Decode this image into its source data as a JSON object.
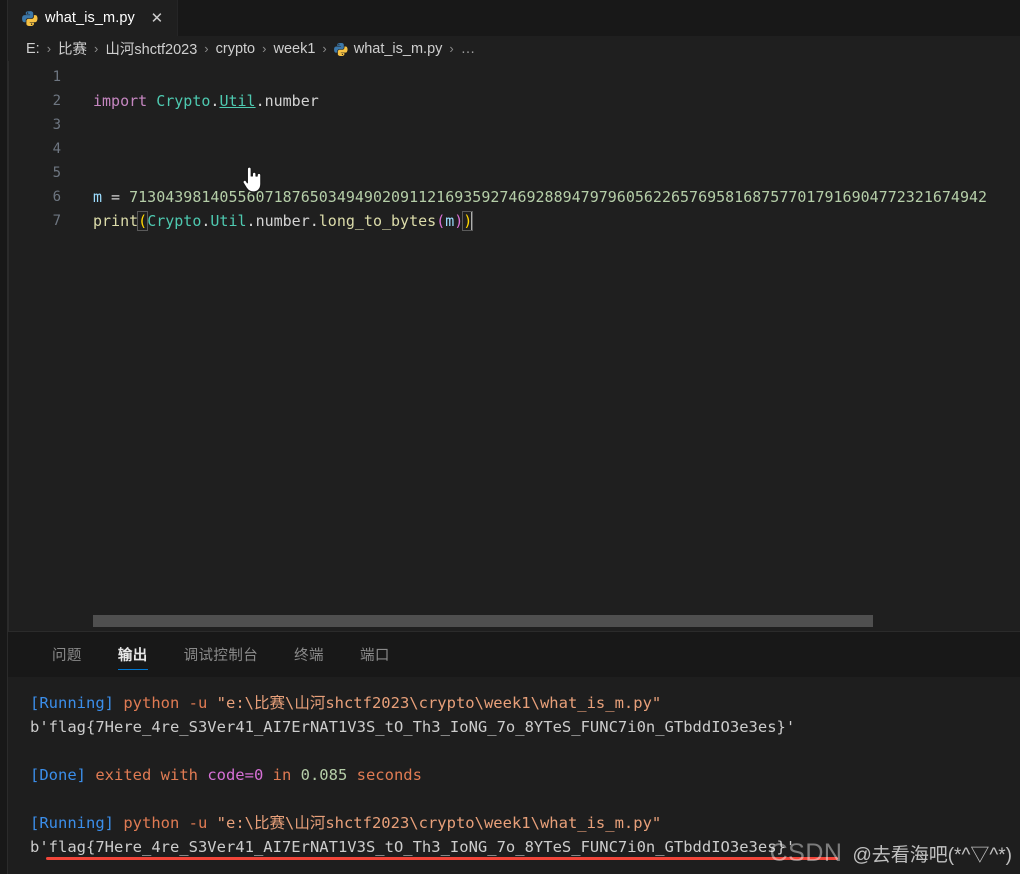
{
  "window": {
    "app": "Visual Studio Code"
  },
  "tabbar": {
    "tabs": [
      {
        "label": "what_is_m.py",
        "icon": "python-icon",
        "close": "✕",
        "active": true
      }
    ]
  },
  "breadcrumb": {
    "separator": "›",
    "items": [
      {
        "label": "E:"
      },
      {
        "label": "比赛"
      },
      {
        "label": "山河shctf2023"
      },
      {
        "label": "crypto"
      },
      {
        "label": "week1"
      },
      {
        "label": "what_is_m.py",
        "icon": "python-icon"
      },
      {
        "label": "…"
      }
    ]
  },
  "editor": {
    "line_numbers": [
      "1",
      "2",
      "3",
      "4",
      "5",
      "6",
      "7"
    ],
    "lines": [
      {
        "n": "1",
        "tokens": []
      },
      {
        "n": "2",
        "tokens": [
          {
            "t": "import ",
            "c": "kw"
          },
          {
            "t": "Crypto",
            "c": "mod"
          },
          {
            "t": ".",
            "c": "plain"
          },
          {
            "t": "Util",
            "c": "mod uline"
          },
          {
            "t": ".",
            "c": "plain"
          },
          {
            "t": "number",
            "c": "plain"
          }
        ]
      },
      {
        "n": "3",
        "tokens": []
      },
      {
        "n": "4",
        "tokens": []
      },
      {
        "n": "5",
        "tokens": []
      },
      {
        "n": "6",
        "tokens": [
          {
            "t": "m",
            "c": "var"
          },
          {
            "t": " = ",
            "c": "op"
          },
          {
            "t": "71304398140556071876503494902091121693592746928894797960562265769581687577017916904772321674942",
            "c": "num"
          }
        ]
      },
      {
        "n": "7",
        "tokens": [
          {
            "t": "print",
            "c": "fn"
          },
          {
            "t": "(",
            "c": "paren1 brkt-box"
          },
          {
            "t": "Crypto",
            "c": "mod"
          },
          {
            "t": ".",
            "c": "plain"
          },
          {
            "t": "Util",
            "c": "mod"
          },
          {
            "t": ".",
            "c": "plain"
          },
          {
            "t": "number",
            "c": "plain"
          },
          {
            "t": ".",
            "c": "plain"
          },
          {
            "t": "long_to_bytes",
            "c": "fn"
          },
          {
            "t": "(",
            "c": "paren2"
          },
          {
            "t": "m",
            "c": "var"
          },
          {
            "t": ")",
            "c": "paren2"
          },
          {
            "t": ")",
            "c": "paren1 brkt-box"
          }
        ]
      }
    ],
    "cursor_line": "7",
    "mouse_cursor": "pointing-hand-cursor",
    "hscrollbar": {
      "name": "horizontal-scrollbar"
    }
  },
  "panel": {
    "tabs": [
      {
        "label": "问题",
        "active": false
      },
      {
        "label": "输出",
        "active": true
      },
      {
        "label": "调试控制台",
        "active": false
      },
      {
        "label": "终端",
        "active": false
      },
      {
        "label": "端口",
        "active": false
      }
    ],
    "output": [
      {
        "type": "run",
        "parts": [
          {
            "t": "[Running] ",
            "c": "t-blue"
          },
          {
            "t": "python -u ",
            "c": "t-orange"
          },
          {
            "t": "\"e:\\比赛\\山河shctf2023\\crypto\\week1\\what_is_m.py\"",
            "c": "t-ltorange"
          }
        ]
      },
      {
        "type": "flag",
        "parts": [
          {
            "t": "b'flag{7Here_4re_S3Ver41_AI7ErNAT1V3S_tO_Th3_IoNG_7o_8YTeS_FUNC7i0n_GTbddIO3e3es}'",
            "c": "t-white"
          }
        ]
      },
      {
        "type": "blank",
        "parts": []
      },
      {
        "type": "done",
        "parts": [
          {
            "t": "[Done] ",
            "c": "t-blue"
          },
          {
            "t": "exited with ",
            "c": "t-orange"
          },
          {
            "t": "code=0",
            "c": "t-magenta"
          },
          {
            "t": " in ",
            "c": "t-orange"
          },
          {
            "t": "0.085",
            "c": "t-green"
          },
          {
            "t": " seconds",
            "c": "t-orange"
          }
        ]
      },
      {
        "type": "blank",
        "parts": []
      },
      {
        "type": "run",
        "parts": [
          {
            "t": "[Running] ",
            "c": "t-blue"
          },
          {
            "t": "python -u ",
            "c": "t-orange"
          },
          {
            "t": "\"e:\\比赛\\山河shctf2023\\crypto\\week1\\what_is_m.py\"",
            "c": "t-ltorange"
          }
        ]
      },
      {
        "type": "flag",
        "parts": [
          {
            "t": "b'flag{7Here_4re_S3Ver41_AI7ErNAT1V3S_tO_Th3_IoNG_7o_8YTeS_FUNC7i0n_GTbddIO3e3es}'",
            "c": "t-white"
          }
        ]
      }
    ],
    "annotation": {
      "name": "red-underline",
      "color": "#f2463a"
    }
  },
  "watermark": {
    "brand": "CSDN",
    "user": "@去看海吧(*^▽^*)"
  },
  "colors": {
    "accent": "#0078d4",
    "editor_bg": "#1f1f1f",
    "panel_bg": "#1e1e1e",
    "annotation_red": "#f2463a"
  }
}
